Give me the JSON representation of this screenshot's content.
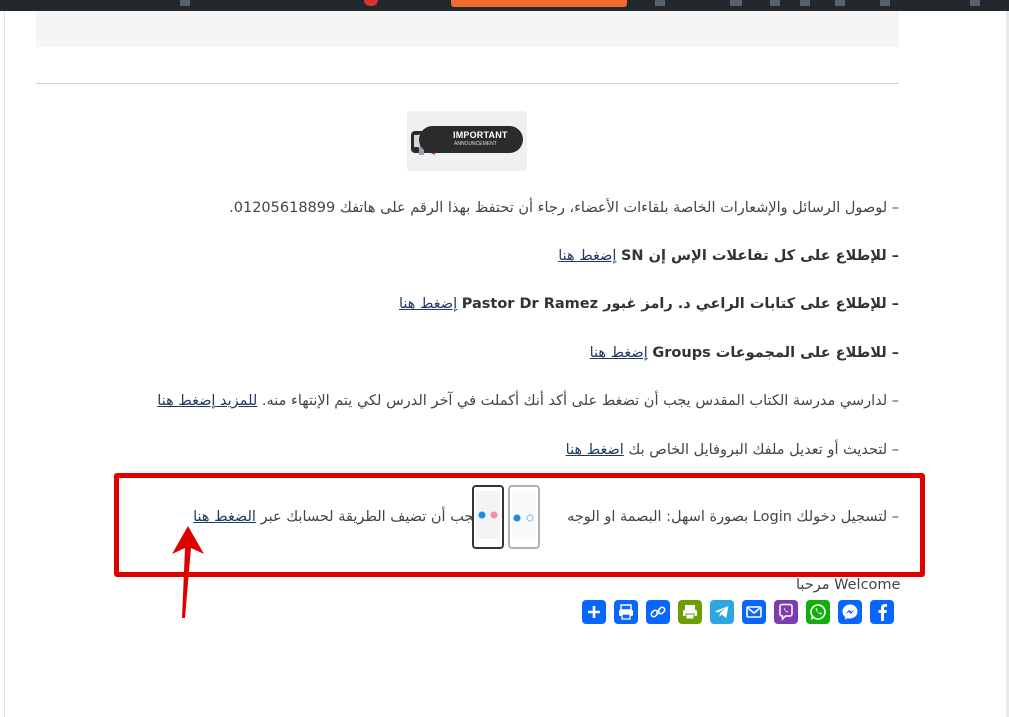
{
  "content": {
    "banner": {
      "line1": "IMPORTANT",
      "line2": "ANNOUNCEMENT"
    },
    "line1": "– لوصول الرسائل والإشعارات الخاصة بلقاءات الأعضاء، رجاء أن تحتفظ بهذا الرقم على هاتفك 01205618899.",
    "line2": {
      "prefix": "– للإطلاع على كل تفاعلات  الإس إن SN",
      "link": "إضغط هنا"
    },
    "line3": {
      "prefix": "– للإطلاع على كتابات الراعي د. رامز غبور Pastor Dr Ramez",
      "link": "إضغط هنا"
    },
    "line4": {
      "prefix": "– للاطلاع على المجموعات Groups",
      "link": "إضغط هنا"
    },
    "line5": {
      "prefix": "– لدارسي مدرسة الكتاب المقدس يجب أن تضغط على أكد أنك أكملت في آخر الدرس لكي يتم الإنتهاء منه.",
      "link": "للمزيد إضغط هنا"
    },
    "line6": {
      "prefix": "– لتحديث أو تعديل ملفك البروفايل الخاص بك",
      "link": "اضغط هنا"
    },
    "line7": {
      "part1": "– لتسجيل دخولك Login بصورة اسهل: البصمة او الوجه",
      "part2": "يجب أن تضيف الطريقة لحسابك عبر",
      "link": "الضغط هنا"
    }
  },
  "welcome": "Welcome مرحبا",
  "share": [
    {
      "name": "facebook-icon",
      "color": "#0866ff"
    },
    {
      "name": "messenger-icon",
      "color": "#0866ff"
    },
    {
      "name": "whatsapp-icon",
      "color": "#12af0a"
    },
    {
      "name": "viber-icon",
      "color": "#7d3daf"
    },
    {
      "name": "email-icon",
      "color": "#0866ff"
    },
    {
      "name": "telegram-icon",
      "color": "#2ca5e0"
    },
    {
      "name": "printfriendly-icon",
      "color": "#6d9f00"
    },
    {
      "name": "copy-link-icon",
      "color": "#0866ff"
    },
    {
      "name": "print-icon",
      "color": "#0866ff"
    },
    {
      "name": "share-more-icon",
      "color": "#0866ff"
    }
  ],
  "colors": {
    "highlight_border": "#e00000",
    "link": "#1e3a5f",
    "admin_bar": "#23282d"
  }
}
